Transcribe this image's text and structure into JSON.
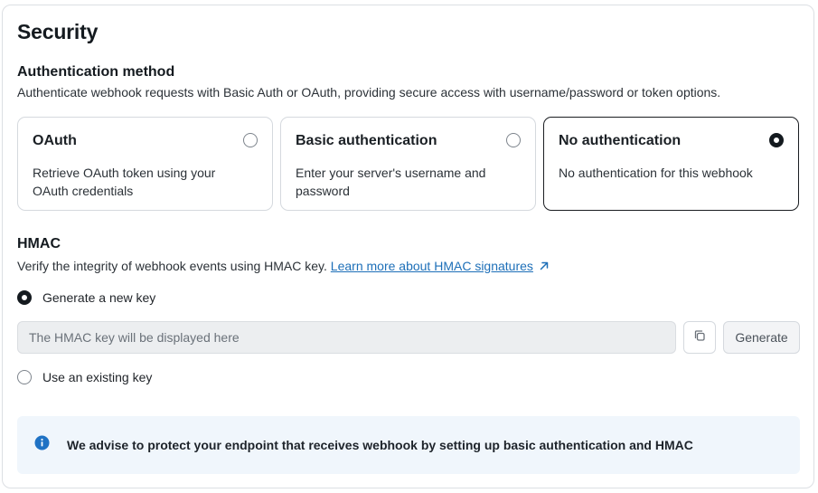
{
  "title": "Security",
  "auth": {
    "heading": "Authentication method",
    "description": "Authenticate webhook requests with Basic Auth or OAuth, providing secure access with username/password or token options.",
    "options": [
      {
        "title": "OAuth",
        "description": "Retrieve OAuth token using your OAuth credentials",
        "selected": false
      },
      {
        "title": "Basic authentication",
        "description": "Enter your server's username and password",
        "selected": false
      },
      {
        "title": "No authentication",
        "description": "No authentication for this webhook",
        "selected": true
      }
    ]
  },
  "hmac": {
    "heading": "HMAC",
    "description": "Verify the integrity of webhook events using HMAC key.",
    "learn_more": "Learn more about HMAC signatures",
    "generate_new_label": "Generate a new key",
    "generate_new_selected": true,
    "key_placeholder": "The HMAC key will be displayed here",
    "generate_button": "Generate",
    "use_existing_label": "Use an existing key",
    "use_existing_selected": false
  },
  "advice": {
    "text": "We advise to protect your endpoint that receives webhook by setting up basic authentication and HMAC"
  },
  "colors": {
    "link": "#1d6fb8",
    "info_icon": "#1f72c4",
    "advice_bg": "#f0f6fc"
  },
  "icons": {
    "external_link": "arrow-up-right-icon",
    "copy": "copy-icon",
    "info": "info-icon"
  }
}
